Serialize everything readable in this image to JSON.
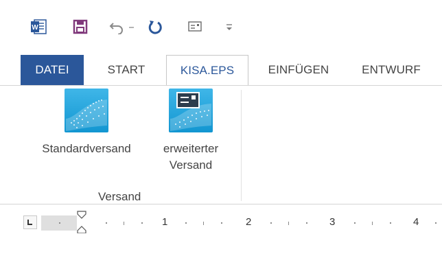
{
  "quick_access": {
    "icons": [
      "word-app-icon",
      "save-icon",
      "undo-icon",
      "undo-dropdown-icon",
      "redo-icon",
      "envelope-icon",
      "customize-toolbar-icon"
    ]
  },
  "tabs": [
    {
      "label": "DATEI"
    },
    {
      "label": "START"
    },
    {
      "label": "KISA.EPS"
    },
    {
      "label": "EINFÜGEN"
    },
    {
      "label": "ENTWURF"
    }
  ],
  "ribbon": {
    "group_label": "Versand",
    "buttons": [
      {
        "label": "Standardversand"
      },
      {
        "label_line1": "erweiterter",
        "label_line2": "Versand"
      }
    ]
  },
  "ruler": {
    "numbers": [
      "1",
      "2",
      "3",
      "4"
    ]
  },
  "colors": {
    "file_tab_bg": "#2b579a",
    "accent_blue": "#2b579a",
    "save_purple": "#80397b",
    "icon_cyan": "#1aa3dc"
  }
}
